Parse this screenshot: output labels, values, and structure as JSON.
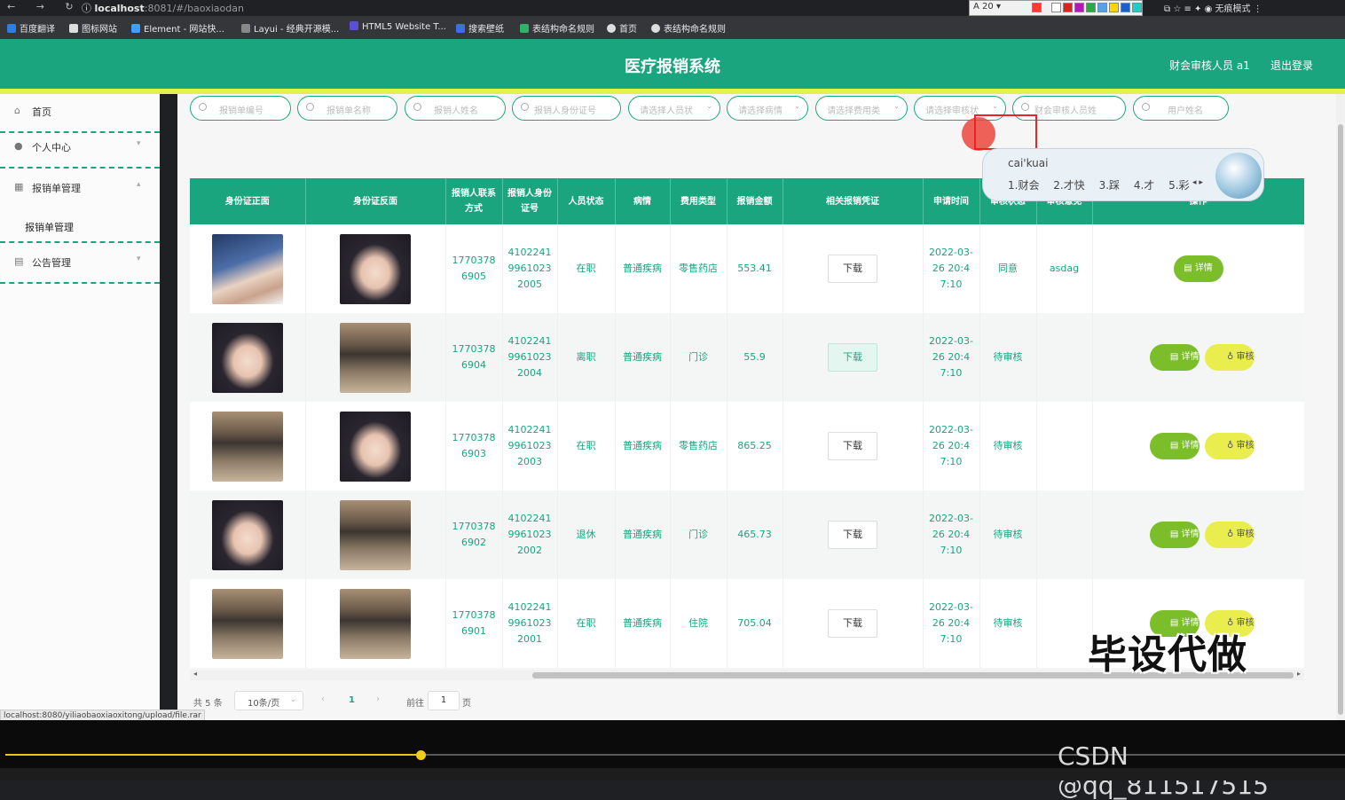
{
  "browser": {
    "url_host": "localhost",
    "url_path": ":8081/#/baoxiaodan",
    "zoom_value": "20",
    "swatch_colors": [
      "#ff3b30",
      "#ffffff",
      "#e02020",
      "#b01ab0",
      "#2ba84a",
      "#5aa0e8",
      "#ffd400",
      "#1b5fc9",
      "#8b8b8b",
      "#28c8c8"
    ],
    "right_label": "无痕模式",
    "bookmarks": [
      "百度翻译",
      "图标网站",
      "Element - 网站快...",
      "Layui - 经典开源模...",
      "HTML5 Website T...",
      "搜索壁纸",
      "表结构命名规则",
      "首页",
      "表结构命名规则"
    ],
    "status_url": "localhost:8080/yiliaobaoxiaoxitong/upload/file.rar"
  },
  "header": {
    "title": "医疗报销系统",
    "user": "财会审核人员 a1",
    "logout": "退出登录",
    "color": "#1aa57f"
  },
  "sidebar": {
    "items": [
      {
        "label": "首页",
        "icon": "home-icon"
      },
      {
        "label": "个人中心",
        "icon": "user-icon"
      },
      {
        "label": "报销单管理",
        "icon": "grid-icon"
      },
      {
        "label": "公告管理",
        "icon": "notice-icon"
      }
    ],
    "sub_item": "报销单管理"
  },
  "filters": [
    "报销单编号",
    "报销单名称",
    "报销人姓名",
    "报销人身份证号",
    "请选择人员状",
    "请选择病情",
    "请选择费用类",
    "请选择审核状",
    "财会审核人员姓",
    "用户姓名"
  ],
  "ime": {
    "pinyin": "cai'kuai",
    "candidates": [
      "1.财会",
      "2.才快",
      "3.踩",
      "4.才",
      "5.彩"
    ]
  },
  "table": {
    "headers": [
      "身份证正面",
      "身份证反面",
      "报销人联系方式",
      "报销人身份证号",
      "人员状态",
      "病情",
      "费用类型",
      "报销金额",
      "相关报销凭证",
      "申请时间",
      "审核状态",
      "审核意见",
      "操作"
    ],
    "rows": [
      {
        "front": "boy",
        "back": "girl",
        "phone": "17703786905",
        "id": "410224199610232005",
        "status": "在职",
        "illness": "普通疾病",
        "fee": "零售药店",
        "amount": "553.41",
        "voucher": "下载",
        "time": "2022-03-26 20:47:10",
        "audit": "同意",
        "opinion": "asdag",
        "actions": [
          "详情"
        ]
      },
      {
        "front": "girl",
        "back": "man",
        "phone": "17703786904",
        "id": "410224199610232004",
        "status": "离职",
        "illness": "普通疾病",
        "fee": "门诊",
        "amount": "55.9",
        "voucher": "下载",
        "time": "2022-03-26 20:47:10",
        "audit": "待审核",
        "opinion": "",
        "actions": [
          "详情",
          "审核"
        ]
      },
      {
        "front": "man",
        "back": "girl",
        "phone": "17703786903",
        "id": "410224199610232003",
        "status": "在职",
        "illness": "普通疾病",
        "fee": "零售药店",
        "amount": "865.25",
        "voucher": "下载",
        "time": "2022-03-26 20:47:10",
        "audit": "待审核",
        "opinion": "",
        "actions": [
          "详情",
          "审核"
        ]
      },
      {
        "front": "girl",
        "back": "man",
        "phone": "17703786902",
        "id": "410224199610232002",
        "status": "退休",
        "illness": "普通疾病",
        "fee": "门诊",
        "amount": "465.73",
        "voucher": "下载",
        "time": "2022-03-26 20:47:10",
        "audit": "待审核",
        "opinion": "",
        "actions": [
          "详情",
          "审核"
        ]
      },
      {
        "front": "man",
        "back": "man",
        "phone": "17703786901",
        "id": "410224199610232001",
        "status": "在职",
        "illness": "普通疾病",
        "fee": "住院",
        "amount": "705.04",
        "voucher": "下载",
        "time": "2022-03-26 20:47:10",
        "audit": "待审核",
        "opinion": "",
        "actions": [
          "详情",
          "审核"
        ]
      }
    ]
  },
  "pagination": {
    "total": "共 5 条",
    "page_size": "10条/页",
    "current": "1",
    "goto_label": "前往",
    "goto_value": "1",
    "page_suffix": "页"
  },
  "overlay": {
    "watermark": "毕设代做",
    "csdn": "CSDN @qq_811517515",
    "progress": 0.31
  }
}
